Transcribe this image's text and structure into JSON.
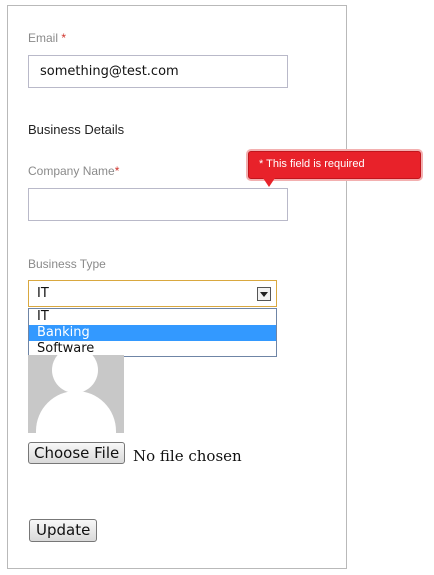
{
  "form": {
    "email_label": "Email",
    "required_marker": "*",
    "email_value": "something@test.com",
    "section_title": "Business Details",
    "company_label": "Company Name",
    "company_value": "",
    "business_type_label": "Business Type",
    "business_type_selected": "IT",
    "business_type_options": [
      "IT",
      "Banking",
      "Software"
    ],
    "highlighted_option": "Banking",
    "validation_message": "* This field is required",
    "file_button_label": "Choose File",
    "file_status": "No file chosen",
    "update_button_label": "Update"
  },
  "icons": {
    "dropdown_arrow": "chevron-down-icon",
    "avatar": "user-placeholder-icon"
  },
  "colors": {
    "required": "#d0342c",
    "tooltip_bg": "#e8222a",
    "select_border": "#d9a83f",
    "option_highlight": "#3399ff"
  }
}
